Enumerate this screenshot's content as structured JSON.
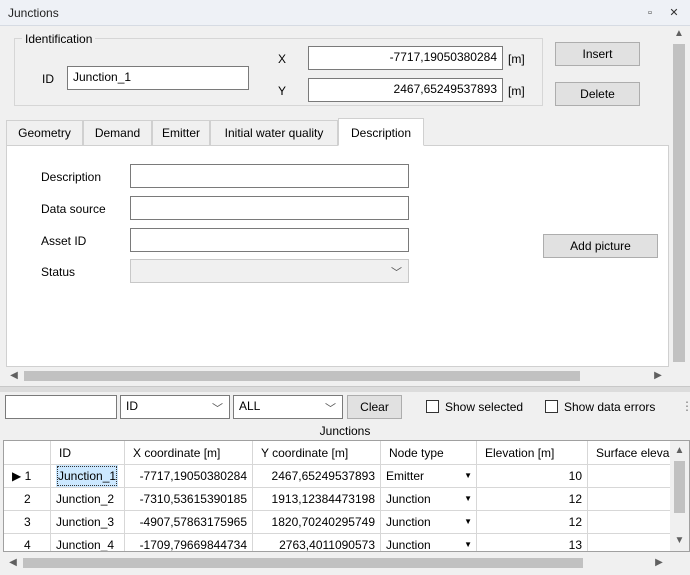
{
  "window": {
    "title": "Junctions"
  },
  "identification": {
    "legend": "Identification",
    "id_label": "ID",
    "id_value": "Junction_1",
    "x_label": "X",
    "x_value": "-7717,19050380284",
    "y_label": "Y",
    "y_value": "2467,65249537893",
    "unit": "[m]",
    "insert_label": "Insert",
    "delete_label": "Delete"
  },
  "tabs": [
    {
      "label": "Geometry"
    },
    {
      "label": "Demand"
    },
    {
      "label": "Emitter"
    },
    {
      "label": "Initial water quality"
    },
    {
      "label": "Description"
    }
  ],
  "description_form": {
    "description_label": "Description",
    "description_value": "",
    "data_source_label": "Data source",
    "data_source_value": "",
    "asset_id_label": "Asset ID",
    "asset_id_value": "",
    "status_label": "Status",
    "status_value": "",
    "add_picture_label": "Add picture"
  },
  "filter_bar": {
    "search_value": "",
    "field_value": "ID",
    "scope_value": "ALL",
    "clear_label": "Clear",
    "show_selected_label": "Show selected",
    "show_errors_label": "Show data errors"
  },
  "grid": {
    "caption": "Junctions",
    "columns": [
      "",
      "ID",
      "X coordinate [m]",
      "Y coordinate [m]",
      "Node type",
      "Elevation [m]",
      "Surface eleva"
    ],
    "rows": [
      {
        "n": "1",
        "id": "Junction_1",
        "x": "-7717,19050380284",
        "y": "2467,65249537893",
        "type": "Emitter",
        "elev": "10"
      },
      {
        "n": "2",
        "id": "Junction_2",
        "x": "-7310,53615390185",
        "y": "1913,12384473198",
        "type": "Junction",
        "elev": "12"
      },
      {
        "n": "3",
        "id": "Junction_3",
        "x": "-4907,57863175965",
        "y": "1820,70240295749",
        "type": "Junction",
        "elev": "12"
      },
      {
        "n": "4",
        "id": "Junction_4",
        "x": "-1709,79669844734",
        "y": "2763,4011090573",
        "type": "Junction",
        "elev": "13"
      }
    ]
  },
  "colors": {
    "selection": "#cce8ff",
    "titlebar": "#eef1f6"
  }
}
